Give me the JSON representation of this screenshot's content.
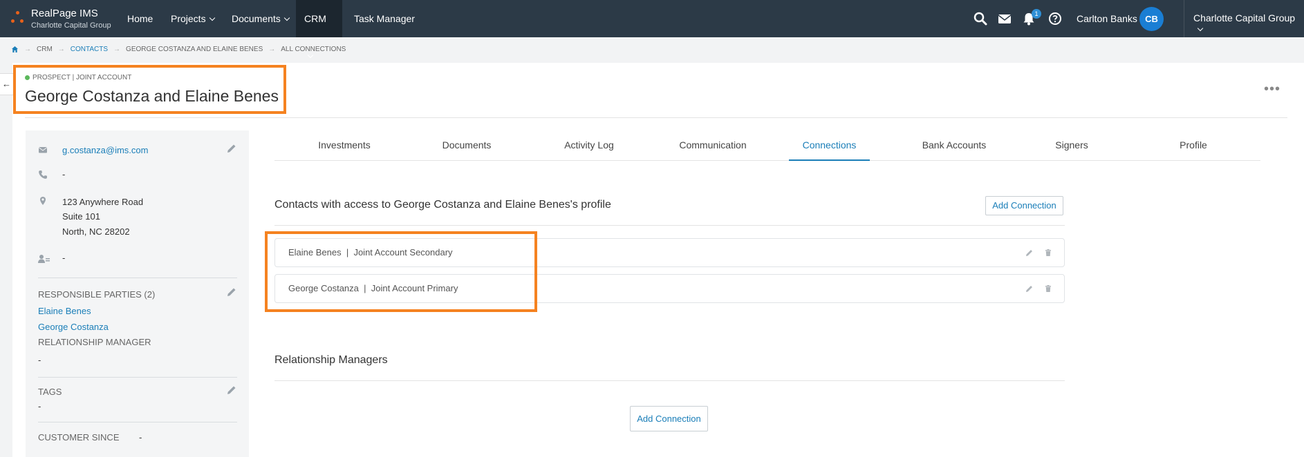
{
  "app": {
    "name": "RealPage IMS",
    "org": "Charlotte Capital Group"
  },
  "nav": {
    "items": [
      {
        "label": "Home"
      },
      {
        "label": "Projects"
      },
      {
        "label": "Documents"
      },
      {
        "label": "CRM"
      },
      {
        "label": "Task Manager"
      }
    ],
    "notification_count": "1",
    "user_name": "Carlton Banks",
    "user_initials": "CB",
    "company": "Charlotte Capital Group"
  },
  "breadcrumb": [
    "CRM",
    "CONTACTS",
    "GEORGE COSTANZA AND ELAINE BENES",
    "ALL CONNECTIONS"
  ],
  "contact": {
    "status": "PROSPECT | JOINT ACCOUNT",
    "name": "George Costanza and Elaine Benes",
    "email": "g.costanza@ims.com",
    "phone": "-",
    "address_line1": "123 Anywhere Road",
    "address_line2": "Suite 101",
    "address_line3": "North, NC 28202",
    "contact_person": "-",
    "responsible_parties_label": "RESPONSIBLE PARTIES (2)",
    "responsible_parties": [
      "Elaine Benes",
      "George Costanza"
    ],
    "relationship_manager_label": "RELATIONSHIP MANAGER",
    "relationship_manager": "-",
    "tags_label": "TAGS",
    "tags": "-",
    "customer_since_label": "CUSTOMER SINCE",
    "customer_since": "-"
  },
  "tabs": [
    "Investments",
    "Documents",
    "Activity Log",
    "Communication",
    "Connections",
    "Bank Accounts",
    "Signers",
    "Profile"
  ],
  "connections": {
    "heading": "Contacts with access to George Costanza and Elaine Benes's profile",
    "add_label": "Add Connection",
    "rows": [
      {
        "name": "Elaine Benes",
        "role": "Joint Account Secondary"
      },
      {
        "name": "George Costanza",
        "role": "Joint Account Primary"
      }
    ]
  },
  "relationship_managers": {
    "heading": "Relationship Managers",
    "add_label": "Add Connection"
  },
  "colors": {
    "accent": "#1a7eb8",
    "nav_bg": "#2c3a47",
    "highlight": "#f58220",
    "logo": "#e8611a"
  }
}
